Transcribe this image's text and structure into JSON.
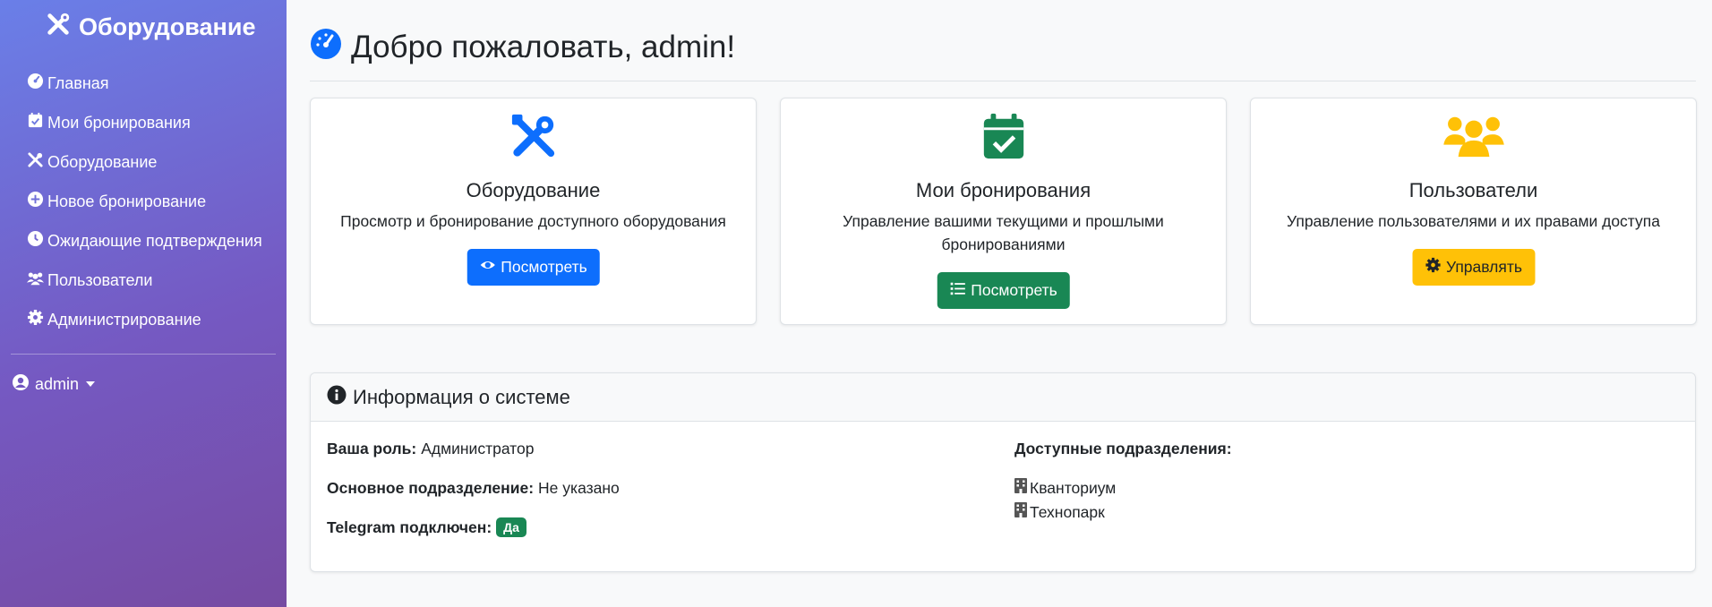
{
  "colors": {
    "sidebar_start": "#6a7fe8",
    "sidebar_end": "#764ba2",
    "primary": "#0d6efd",
    "success": "#198754",
    "warning": "#ffc107"
  },
  "sidebar": {
    "brand": "Оборудование",
    "brand_icon": "tools-icon",
    "items": [
      {
        "label": "Главная",
        "icon": "dashboard-icon"
      },
      {
        "label": "Мои бронирования",
        "icon": "calendar-check-icon"
      },
      {
        "label": "Оборудование",
        "icon": "tools-icon"
      },
      {
        "label": "Новое бронирование",
        "icon": "plus-circle-icon"
      },
      {
        "label": "Ожидающие подтверждения",
        "icon": "clock-icon"
      },
      {
        "label": "Пользователи",
        "icon": "users-icon"
      },
      {
        "label": "Администрирование",
        "icon": "gear-icon"
      }
    ],
    "user": "admin"
  },
  "main": {
    "title": "Добро пожаловать, admin!",
    "cards": [
      {
        "title": "Оборудование",
        "text": "Просмотр и бронирование доступного оборудования",
        "button": "Посмотреть",
        "icon": "tools-icon",
        "button_icon": "eye-icon"
      },
      {
        "title": "Мои бронирования",
        "text": "Управление вашими текущими и прошлыми бронированиями",
        "button": "Посмотреть",
        "icon": "calendar-check-icon",
        "button_icon": "list-icon"
      },
      {
        "title": "Пользователи",
        "text": "Управление пользователями и их правами доступа",
        "button": "Управлять",
        "icon": "users-icon",
        "button_icon": "gear-icon"
      }
    ],
    "info": {
      "header": "Информация о системе",
      "role_label": "Ваша роль:",
      "role_value": "Администратор",
      "dept_label": "Основное подразделение:",
      "dept_value": "Не указано",
      "telegram_label": "Telegram подключен:",
      "telegram_value": "Да",
      "available_label": "Доступные подразделения:",
      "departments": [
        "Кванториум",
        "Технопарк"
      ]
    }
  }
}
